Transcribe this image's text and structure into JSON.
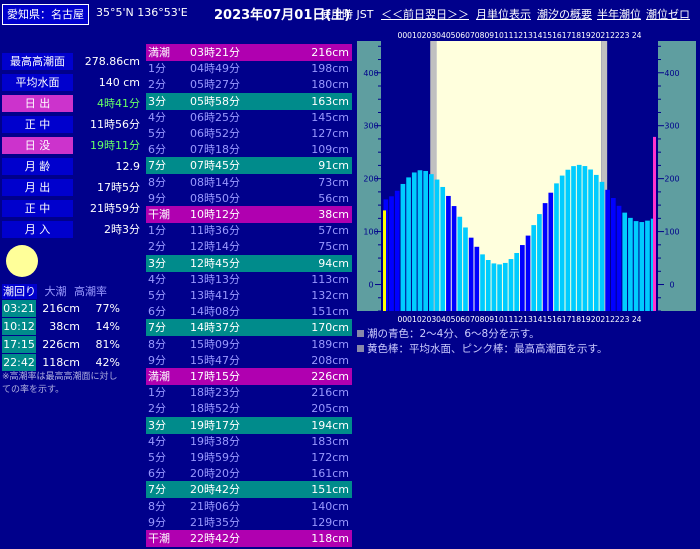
{
  "header": {
    "location": "愛知県：名古屋",
    "coords": "35°5'N 136°53'E",
    "date": "2023年07月01日(土)",
    "jst": "使用時 JST",
    "nav": [
      "＜＜前日",
      "翌日＞＞",
      "月単位表示",
      "潮汐の概要",
      "半年潮位",
      "潮位ゼロ"
    ]
  },
  "info": [
    {
      "label": "最高高潮面",
      "value": "278.86cm",
      "hl": false,
      "green": false
    },
    {
      "label": "平均水面",
      "value": "140 cm",
      "hl": false,
      "green": false
    },
    {
      "label": "日 出",
      "value": "4時41分",
      "hl": true,
      "green": true
    },
    {
      "label": "正 中",
      "value": "11時56分",
      "hl": false,
      "green": false
    },
    {
      "label": "日 没",
      "value": "19時11分",
      "hl": true,
      "green": true
    },
    {
      "label": "月 齢",
      "value": "12.9",
      "hl": false,
      "green": false
    },
    {
      "label": "月 出",
      "value": "17時5分",
      "hl": false,
      "green": false
    },
    {
      "label": "正 中",
      "value": "21時59分",
      "hl": false,
      "green": false
    },
    {
      "label": "月 入",
      "value": "2時3分",
      "hl": false,
      "green": false
    }
  ],
  "shiokawa": {
    "title": "潮回り",
    "col1": "大潮",
    "col2": "高潮率",
    "rows": [
      {
        "time": "03:21",
        "height": "216cm",
        "pct": "77%"
      },
      {
        "time": "10:12",
        "height": "38cm",
        "pct": "14%"
      },
      {
        "time": "17:15",
        "height": "226cm",
        "pct": "81%"
      },
      {
        "time": "22:42",
        "height": "118cm",
        "pct": "42%"
      }
    ],
    "note": "※高潮率は最高高潮面に対しての率を示す。"
  },
  "tide_table": [
    {
      "a": "満潮",
      "b": "03時21分",
      "c": "216cm",
      "kind": "hi"
    },
    {
      "a": "1分",
      "b": "04時49分",
      "c": "198cm",
      "kind": ""
    },
    {
      "a": "2分",
      "b": "05時27分",
      "c": "180cm",
      "kind": ""
    },
    {
      "a": "3分",
      "b": "05時58分",
      "c": "163cm",
      "kind": "cy"
    },
    {
      "a": "4分",
      "b": "06時25分",
      "c": "145cm",
      "kind": ""
    },
    {
      "a": "5分",
      "b": "06時52分",
      "c": "127cm",
      "kind": ""
    },
    {
      "a": "6分",
      "b": "07時18分",
      "c": "109cm",
      "kind": ""
    },
    {
      "a": "7分",
      "b": "07時45分",
      "c": "91cm",
      "kind": "cy"
    },
    {
      "a": "8分",
      "b": "08時14分",
      "c": "73cm",
      "kind": ""
    },
    {
      "a": "9分",
      "b": "08時50分",
      "c": "56cm",
      "kind": ""
    },
    {
      "a": "干潮",
      "b": "10時12分",
      "c": "38cm",
      "kind": "lo"
    },
    {
      "a": "1分",
      "b": "11時36分",
      "c": "57cm",
      "kind": ""
    },
    {
      "a": "2分",
      "b": "12時14分",
      "c": "75cm",
      "kind": ""
    },
    {
      "a": "3分",
      "b": "12時45分",
      "c": "94cm",
      "kind": "cy"
    },
    {
      "a": "4分",
      "b": "13時13分",
      "c": "113cm",
      "kind": ""
    },
    {
      "a": "5分",
      "b": "13時41分",
      "c": "132cm",
      "kind": ""
    },
    {
      "a": "6分",
      "b": "14時08分",
      "c": "151cm",
      "kind": ""
    },
    {
      "a": "7分",
      "b": "14時37分",
      "c": "170cm",
      "kind": "cy"
    },
    {
      "a": "8分",
      "b": "15時09分",
      "c": "189cm",
      "kind": ""
    },
    {
      "a": "9分",
      "b": "15時47分",
      "c": "208cm",
      "kind": ""
    },
    {
      "a": "満潮",
      "b": "17時15分",
      "c": "226cm",
      "kind": "hi"
    },
    {
      "a": "1分",
      "b": "18時23分",
      "c": "216cm",
      "kind": ""
    },
    {
      "a": "2分",
      "b": "18時52分",
      "c": "205cm",
      "kind": ""
    },
    {
      "a": "3分",
      "b": "19時17分",
      "c": "194cm",
      "kind": "cy"
    },
    {
      "a": "4分",
      "b": "19時38分",
      "c": "183cm",
      "kind": ""
    },
    {
      "a": "5分",
      "b": "19時59分",
      "c": "172cm",
      "kind": ""
    },
    {
      "a": "6分",
      "b": "20時20分",
      "c": "161cm",
      "kind": ""
    },
    {
      "a": "7分",
      "b": "20時42分",
      "c": "151cm",
      "kind": "cy"
    },
    {
      "a": "8分",
      "b": "21時06分",
      "c": "140cm",
      "kind": ""
    },
    {
      "a": "9分",
      "b": "21時35分",
      "c": "129cm",
      "kind": ""
    },
    {
      "a": "干潮",
      "b": "22時42分",
      "c": "118cm",
      "kind": "lo"
    }
  ],
  "chart_data": {
    "type": "bar",
    "hours_label": "000102030405060708091011121314151617181920212223 24",
    "y_ticks": [
      0,
      100,
      200,
      300,
      400
    ],
    "ylim": [
      -50,
      460
    ],
    "sunrise_hour": 4.68,
    "sunset_hour": 19.18,
    "mean_level": 140,
    "max_level": 278.86,
    "colors": {
      "light": "#00ccff",
      "dark": "#0000ff",
      "yellow": "#ffff00",
      "pink": "#ff33cc",
      "sky": "#ffffdd",
      "gray": "#c0c0c0"
    }
  },
  "legend": [
    "潮の青色：2〜4分、6〜8分を示す。",
    "黄色棒：平均水面、ピンク棒：最高高潮面を示す。"
  ]
}
